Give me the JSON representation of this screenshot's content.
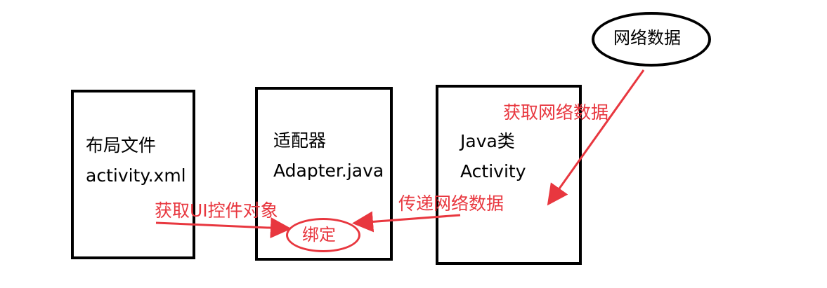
{
  "layout_file": {
    "line1": "布局文件",
    "line2": "activity.xml"
  },
  "adapter": {
    "line1": "适配器",
    "line2": "Adapter.java"
  },
  "java_class": {
    "line1": "Java类",
    "line2": "Activity"
  },
  "network_data": "网络数据",
  "bind": "绑定",
  "arrows": {
    "get_network_data": "获取网络数据",
    "pass_network_data": "传递网络数据",
    "get_ui_controls": "获取UI控件对象"
  },
  "colors": {
    "arrow": "#e8373f",
    "box": "#000000"
  }
}
